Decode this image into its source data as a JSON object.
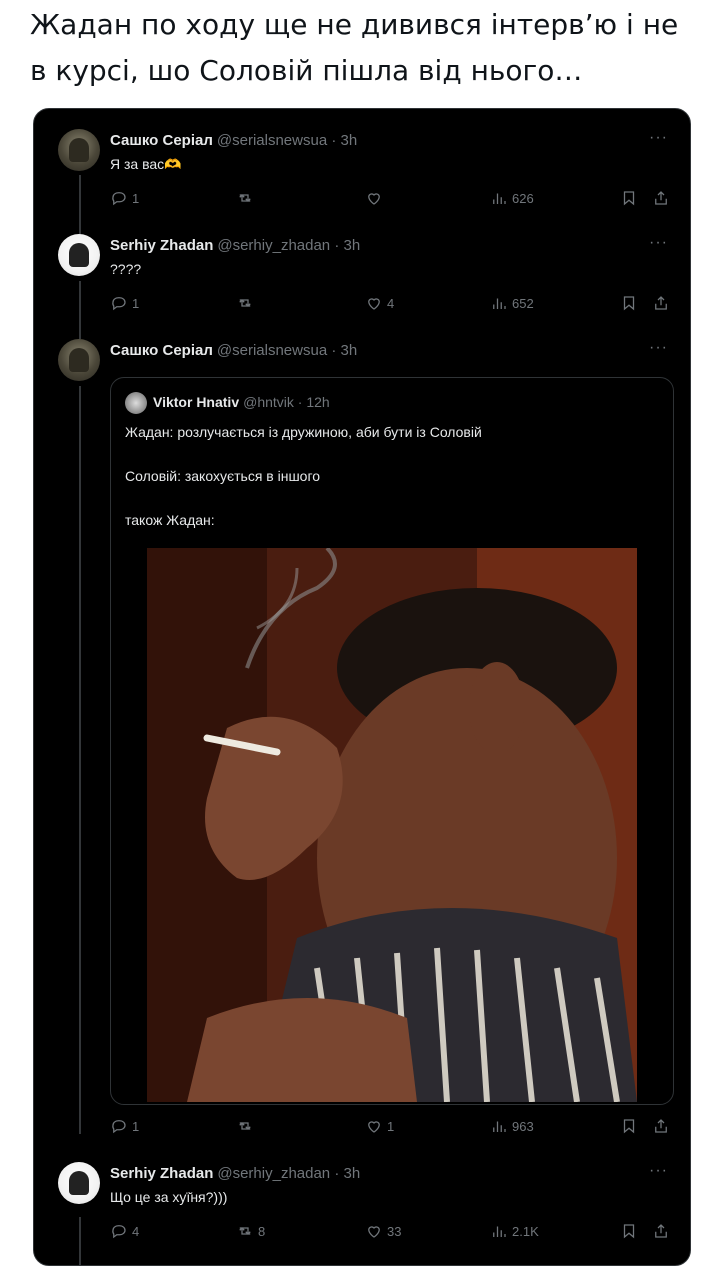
{
  "caption": "Жадан по ходу ще не дивився інтерв’ю і не в курсі, шо Соловій пішла від нього…",
  "more_icon": "···",
  "posts": [
    {
      "name": "Сашко Серіал",
      "handle": "@serialsnewsua · 3h",
      "text": "Я за вас🫶",
      "replies": "1",
      "reposts": "",
      "likes": "",
      "views": "626"
    },
    {
      "name": "Serhiy Zhadan",
      "handle": "@serhiy_zhadan · 3h",
      "text": "????",
      "replies": "1",
      "reposts": "",
      "likes": "4",
      "views": "652"
    },
    {
      "name": "Сашко Серіал",
      "handle": "@serialsnewsua · 3h",
      "text": "",
      "replies": "1",
      "reposts": "",
      "likes": "1",
      "views": "963"
    },
    {
      "name": "Serhiy Zhadan",
      "handle": "@serhiy_zhadan · 3h",
      "text": "Що це за хуї̆ня?)))",
      "replies": "4",
      "reposts": "8",
      "likes": "33",
      "views": "2.1K"
    }
  ],
  "quote": {
    "name": "Viktor Hnativ",
    "handle": "@hntvik · 12h",
    "line1": "Жадан: розлучається із дружиною, аби бути із Соловій",
    "line2": "Соловій: закохується в іншого",
    "line3": "також Жадан:"
  },
  "icons": [
    "reply-icon",
    "repost-icon",
    "like-icon",
    "views-icon",
    "bookmark-icon",
    "share-icon"
  ]
}
